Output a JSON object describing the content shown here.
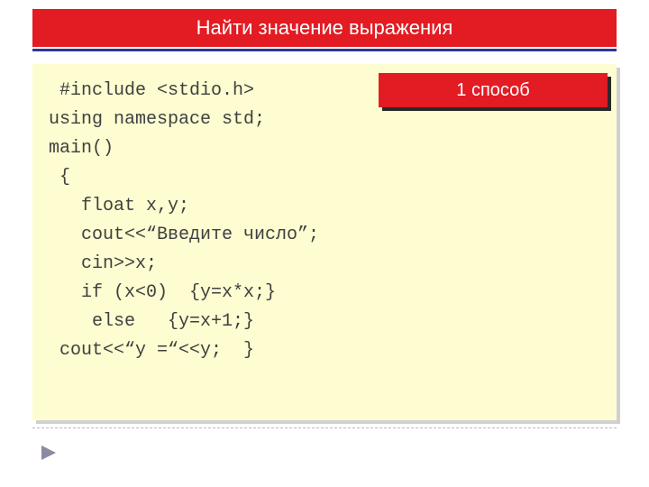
{
  "colors": {
    "red": "#e31b23",
    "navy": "#2b3a8f",
    "code_bg": "#fdfdd1",
    "code_text": "#404040"
  },
  "title": "Найти значение выражения",
  "badge": "1 способ",
  "code": {
    "l1": " #include <stdio.h>",
    "l2": "using namespace std;",
    "l3": "main()",
    "l4": " {",
    "l5": "   float x,y;",
    "l6": "   cout<<“Введите число”;",
    "l7": "   cin>>x;",
    "l8": "   if (x<0)  {y=x*x;}",
    "l9": "    else   {y=x+1;}",
    "l10": " cout<<“y =“<<y;  }"
  }
}
